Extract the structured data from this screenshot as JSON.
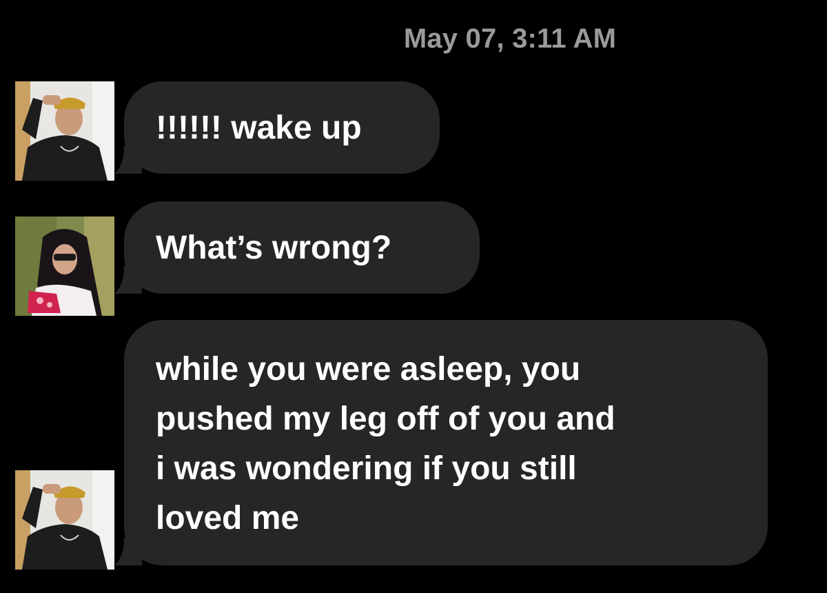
{
  "conversation": {
    "timestamp": "May 07, 3:11 AM",
    "messages": [
      {
        "sender": "male",
        "avatar": "avatar-male",
        "text": "!!!!!! wake up"
      },
      {
        "sender": "female",
        "avatar": "avatar-female",
        "text": "What’s wrong?"
      },
      {
        "sender": "male",
        "avatar": "avatar-male",
        "lines": [
          "while you were asleep, you",
          "pushed my leg off of you and",
          "i was wondering if you still",
          "loved me"
        ]
      }
    ]
  },
  "colors": {
    "background": "#000000",
    "bubble": "#262626",
    "timestamp": "#9a9a9a",
    "text": "#ffffff"
  }
}
